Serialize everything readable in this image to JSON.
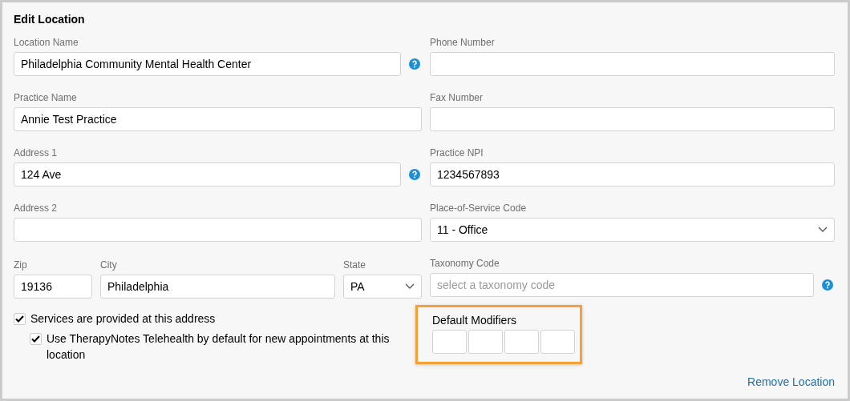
{
  "title": "Edit Location",
  "left_fields": [
    {
      "kind": "text",
      "label": "Location Name",
      "value": "Philadelphia Community Mental Health Center",
      "help": true
    },
    {
      "kind": "text",
      "label": "Practice Name",
      "value": "Annie Test Practice",
      "help": false
    },
    {
      "kind": "text",
      "label": "Address 1",
      "value": "124 Ave",
      "help": true
    },
    {
      "kind": "text",
      "label": "Address 2",
      "help": false
    }
  ],
  "address_row": [
    {
      "kind": "text",
      "label": "Zip",
      "value": "19136"
    },
    {
      "kind": "text",
      "label": "City",
      "value": "Philadelphia"
    },
    {
      "kind": "select",
      "label": "State",
      "value": "PA"
    }
  ],
  "checkboxes": [
    {
      "label": "Services are provided at this address",
      "checked": true,
      "indented": false
    },
    {
      "label": "Use TherapyNotes Telehealth by default for new appointments at this location",
      "checked": true,
      "indented": true
    }
  ],
  "right_fields": [
    {
      "kind": "text",
      "label": "Phone Number",
      "help": false
    },
    {
      "kind": "text",
      "label": "Fax Number",
      "help": false
    },
    {
      "kind": "text",
      "label": "Practice NPI",
      "value": "1234567893",
      "help": false
    },
    {
      "kind": "select",
      "label": "Place-of-Service Code",
      "value": "11 - Office",
      "help": false
    },
    {
      "kind": "text",
      "label": "Taxonomy Code",
      "placeholder": "select a taxonomy code",
      "help": true
    }
  ],
  "default_modifiers": {
    "label": "Default Modifiers",
    "highlighted": true
  },
  "remove_link": "Remove Location"
}
